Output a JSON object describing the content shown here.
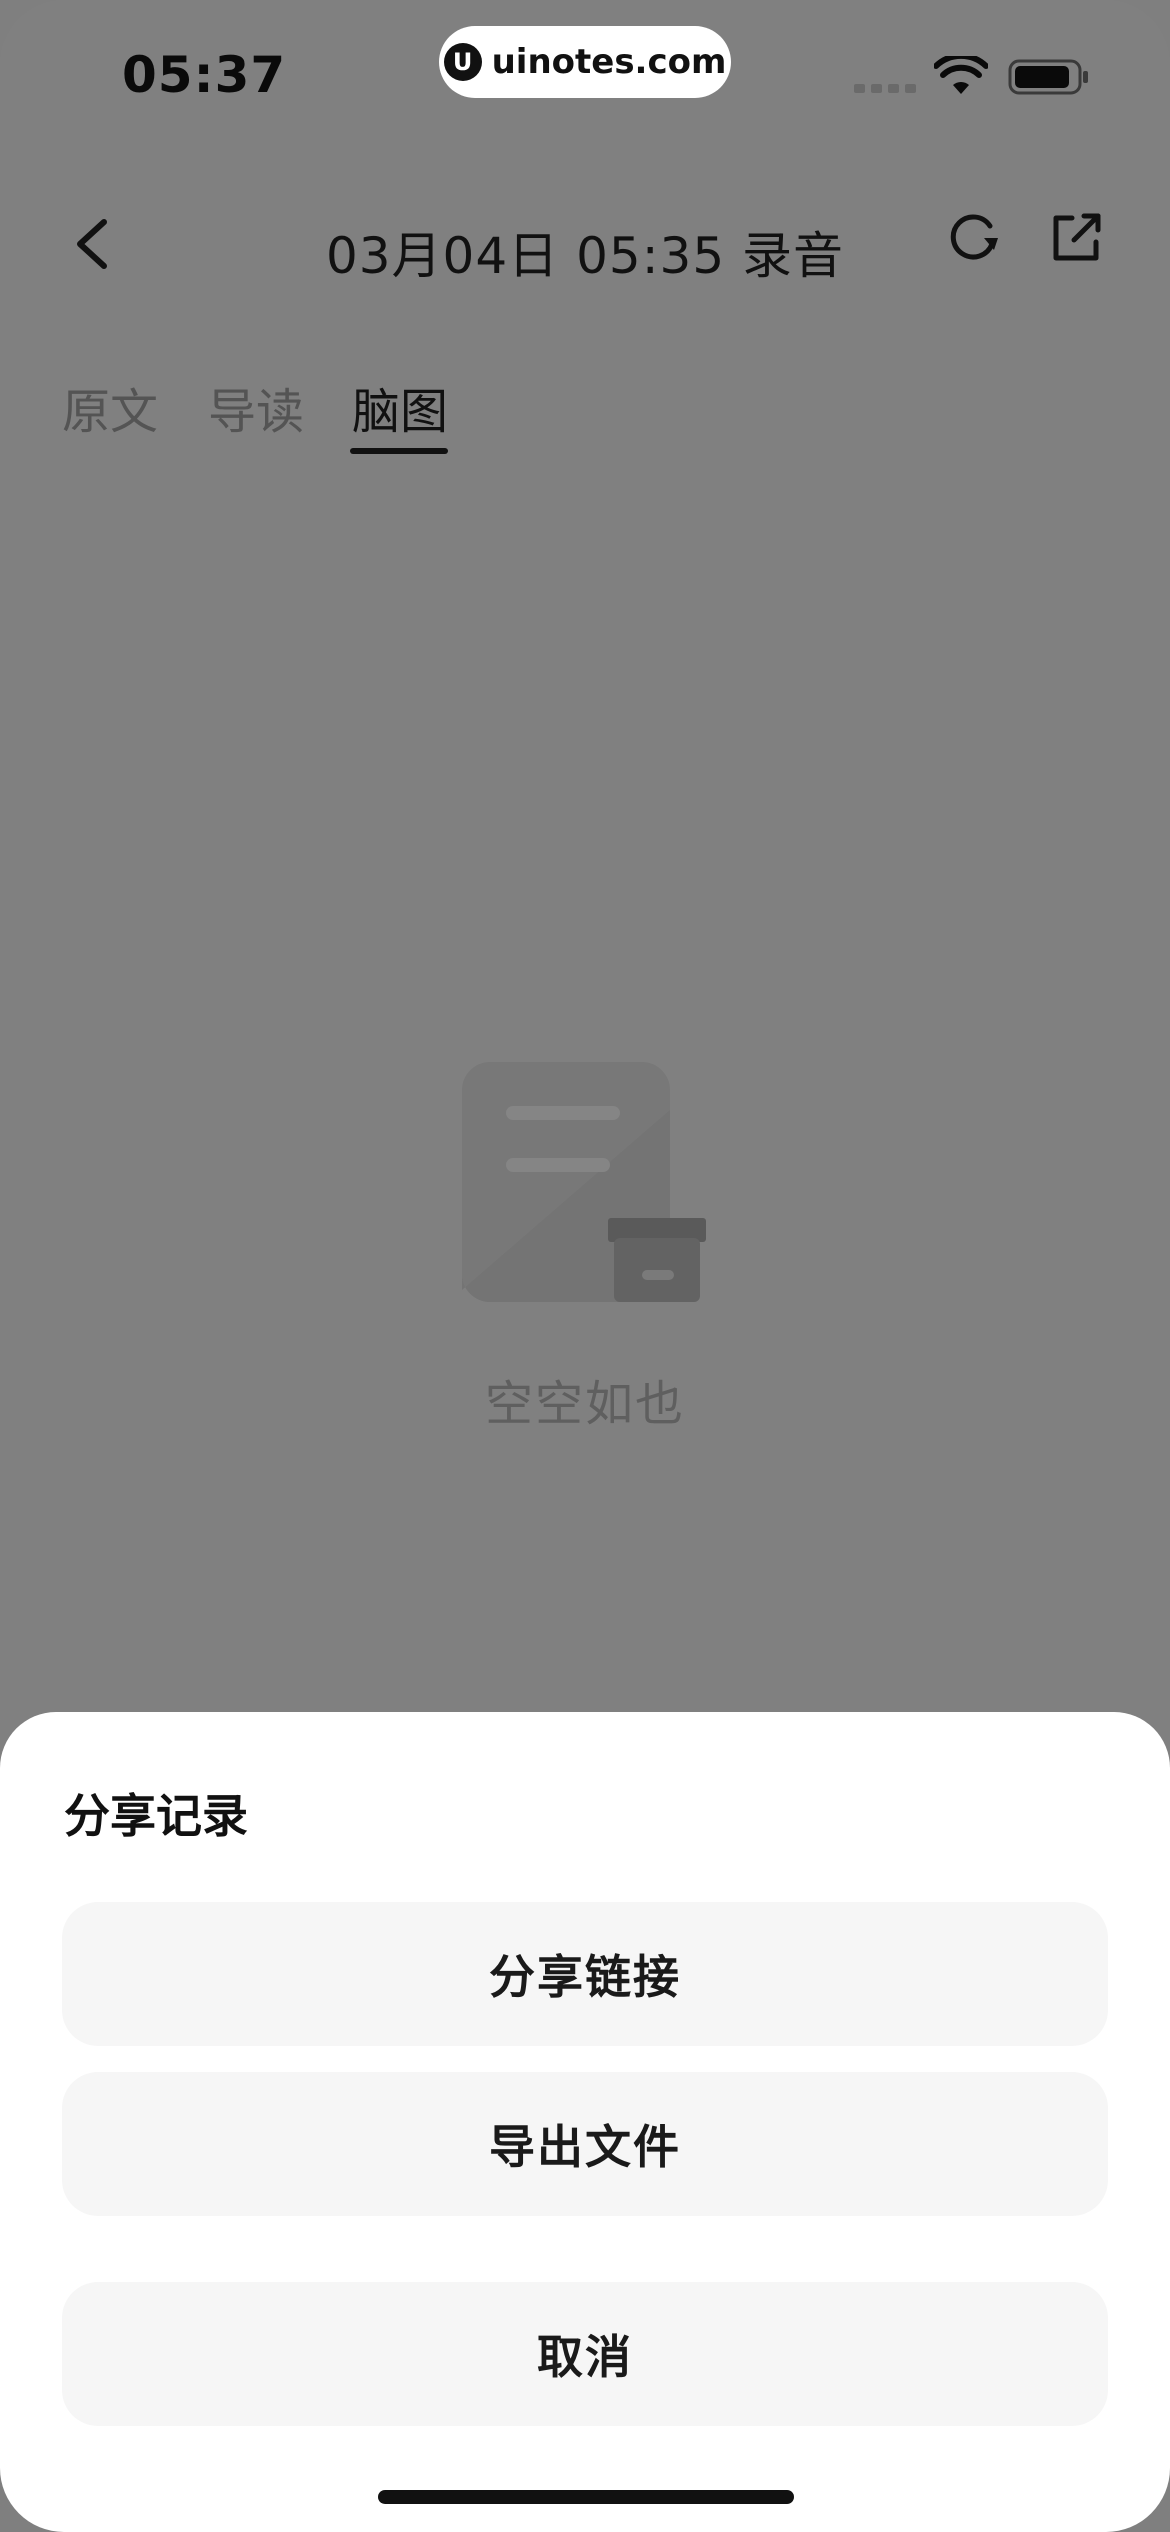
{
  "status_bar": {
    "time": "05:37",
    "watermark_logo": "U",
    "watermark_text": "uinotes.com",
    "icons": [
      "signal-icon",
      "wifi-icon",
      "battery-icon"
    ]
  },
  "header": {
    "title": "03月04日 05:35 录音",
    "icons": [
      "back-icon",
      "refresh-icon",
      "share-icon"
    ]
  },
  "tabs": [
    {
      "label": "原文",
      "active": false
    },
    {
      "label": "导读",
      "active": false
    },
    {
      "label": "脑图",
      "active": true
    }
  ],
  "empty_state": {
    "icon": "empty-document-box-icon",
    "text": "空空如也"
  },
  "share_sheet": {
    "title": "分享记录",
    "share_link_label": "分享链接",
    "export_file_label": "导出文件",
    "cancel_label": "取消"
  },
  "colors": {
    "overlay_background": "#808080",
    "sheet_background": "#ffffff",
    "button_background": "#f6f6f6",
    "text_primary": "#111111"
  }
}
